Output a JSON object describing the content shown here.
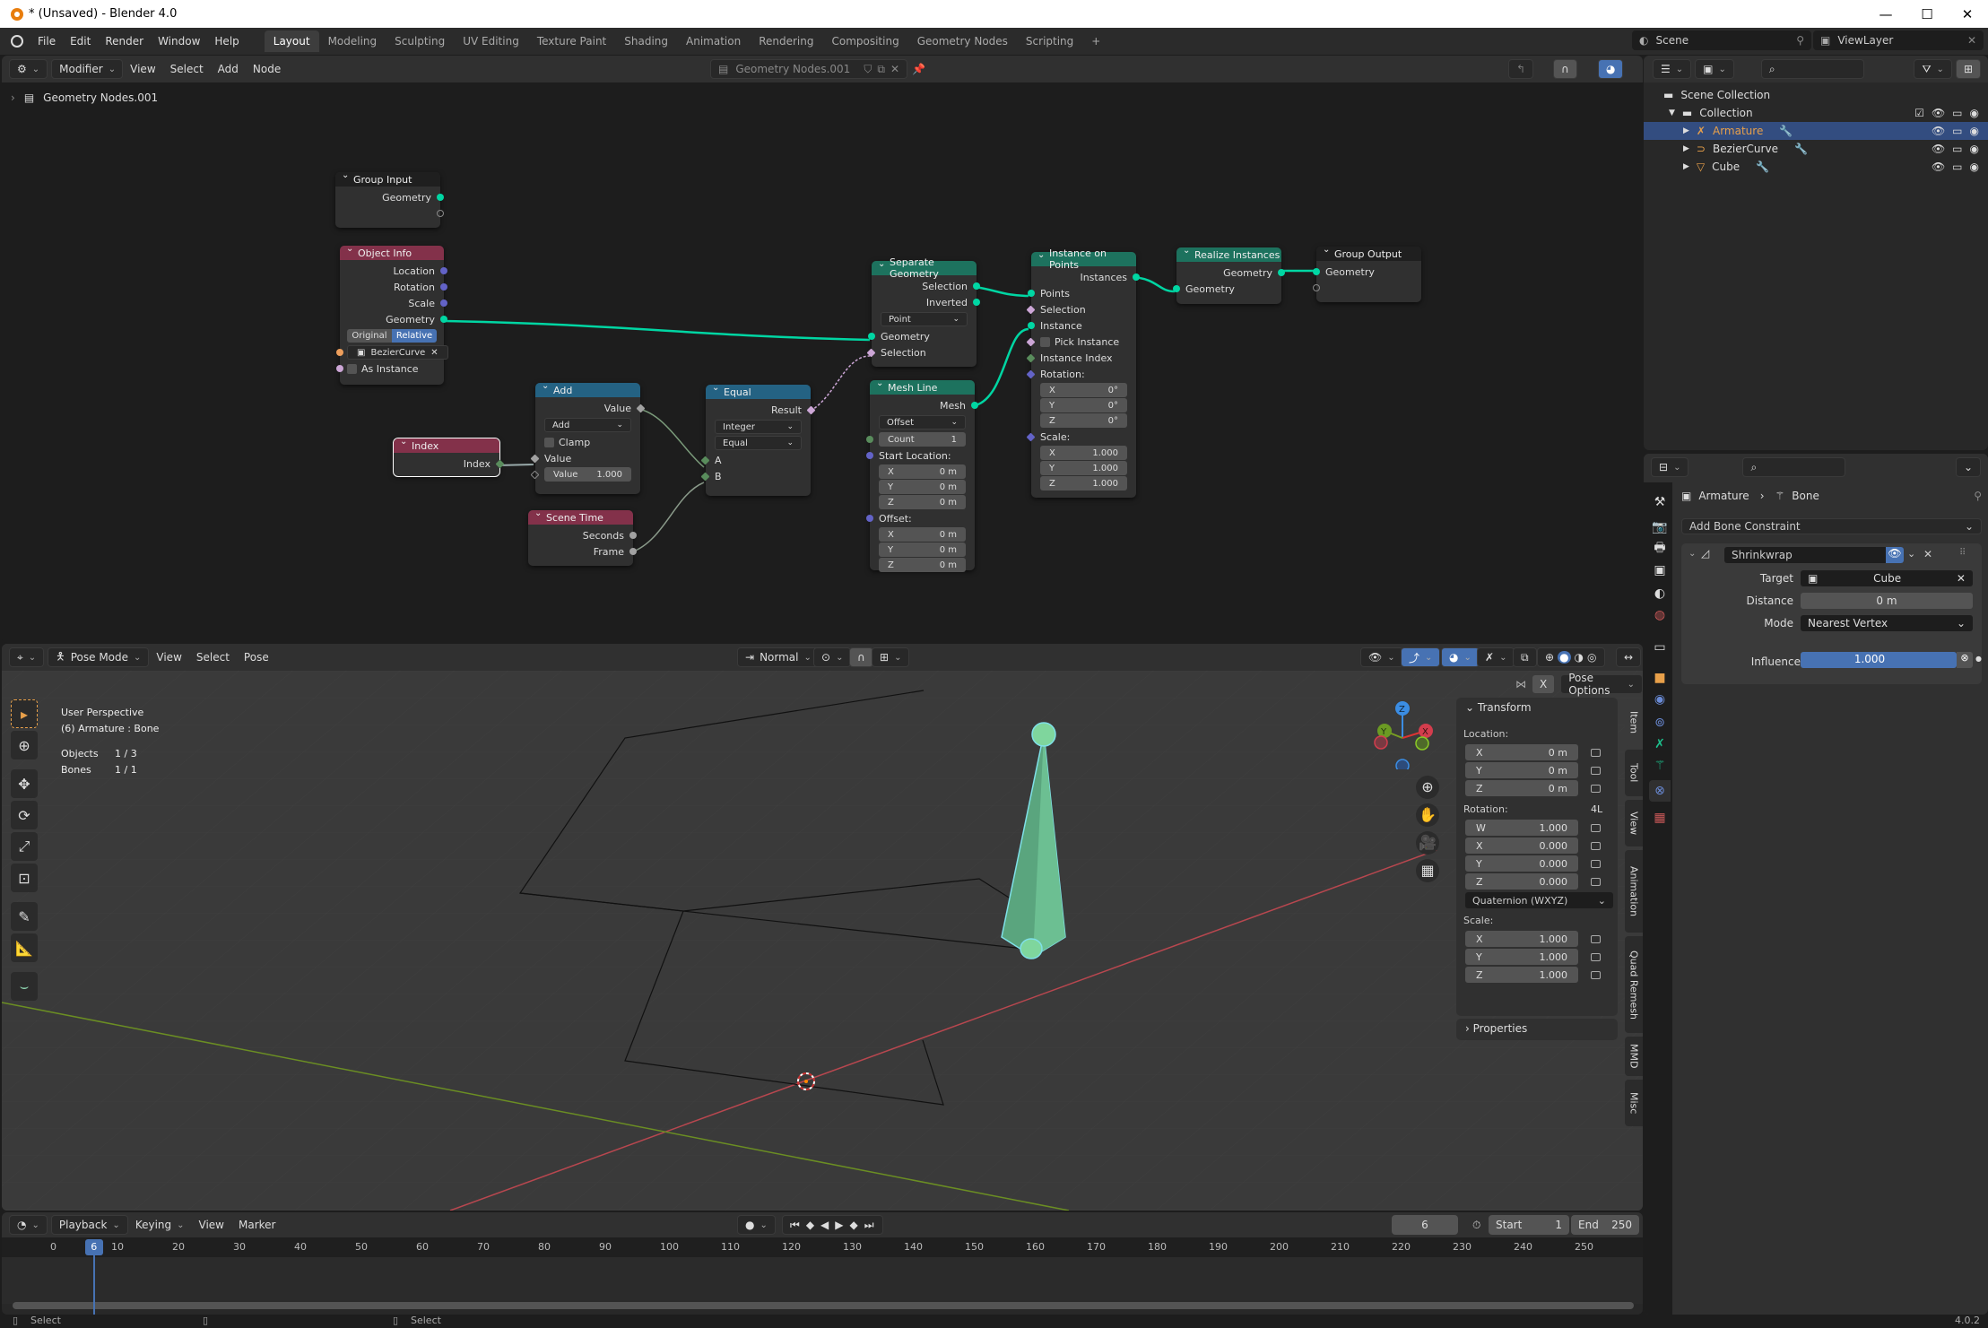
{
  "window": {
    "title": "* (Unsaved) - Blender 4.0",
    "minimize": "—",
    "maximize": "☐",
    "close": "✕"
  },
  "menubar": {
    "menus": [
      "File",
      "Edit",
      "Render",
      "Window",
      "Help"
    ],
    "workspaces": [
      "Layout",
      "Modeling",
      "Sculpting",
      "UV Editing",
      "Texture Paint",
      "Shading",
      "Animation",
      "Rendering",
      "Compositing",
      "Geometry Nodes",
      "Scripting"
    ],
    "active_workspace": "Layout",
    "add_workspace": "+",
    "scene": "Scene",
    "view_layer": "ViewLayer"
  },
  "node_editor": {
    "header": {
      "mode": "Modifier",
      "menus": [
        "View",
        "Select",
        "Add",
        "Node"
      ],
      "node_group": "Geometry Nodes.001"
    },
    "breadcrumb": "Geometry Nodes.001",
    "nodes": {
      "group_input": {
        "title": "Group Input",
        "outputs": [
          "Geometry"
        ]
      },
      "object_info": {
        "title": "Object Info",
        "outputs": [
          "Location",
          "Rotation",
          "Scale",
          "Geometry"
        ],
        "toggle": [
          "Original",
          "Relative"
        ],
        "active_toggle": "Relative",
        "object": "BezierCurve",
        "as_instance": "As Instance"
      },
      "index": {
        "title": "Index",
        "output": "Index"
      },
      "add": {
        "title": "Add",
        "output": "Value",
        "operation": "Add",
        "clamp": "Clamp",
        "input_a": "Value",
        "input_b_label": "Value",
        "input_b_value": "1.000"
      },
      "scene_time": {
        "title": "Scene Time",
        "outputs": [
          "Seconds",
          "Frame"
        ]
      },
      "equal": {
        "title": "Equal",
        "output": "Result",
        "data_type": "Integer",
        "mode": "Equal",
        "inputs": [
          "A",
          "B"
        ]
      },
      "separate_geometry": {
        "title": "Separate Geometry",
        "outputs": [
          "Selection",
          "Inverted"
        ],
        "domain": "Point",
        "inputs": [
          "Geometry",
          "Selection"
        ]
      },
      "mesh_line": {
        "title": "Mesh Line",
        "output": "Mesh",
        "mode": "Offset",
        "count_label": "Count",
        "count": "1",
        "start_label": "Start Location:",
        "start": [
          [
            "X",
            "0 m"
          ],
          [
            "Y",
            "0 m"
          ],
          [
            "Z",
            "0 m"
          ]
        ],
        "offset_label": "Offset:",
        "offset": [
          [
            "X",
            "0 m"
          ],
          [
            "Y",
            "0 m"
          ],
          [
            "Z",
            "0 m"
          ]
        ]
      },
      "instance_on_points": {
        "title": "Instance on Points",
        "output": "Instances",
        "inputs": [
          "Points",
          "Selection",
          "Instance",
          "Pick Instance",
          "Instance Index"
        ],
        "rotation_label": "Rotation:",
        "rotation": [
          [
            "X",
            "0°"
          ],
          [
            "Y",
            "0°"
          ],
          [
            "Z",
            "0°"
          ]
        ],
        "scale_label": "Scale:",
        "scale": [
          [
            "X",
            "1.000"
          ],
          [
            "Y",
            "1.000"
          ],
          [
            "Z",
            "1.000"
          ]
        ]
      },
      "realize_instances": {
        "title": "Realize Instances",
        "output": "Geometry",
        "input": "Geometry"
      },
      "group_output": {
        "title": "Group Output",
        "input": "Geometry"
      }
    }
  },
  "outliner": {
    "root": "Scene Collection",
    "collection": "Collection",
    "items": [
      {
        "name": "Armature",
        "selected": true,
        "color": "#e8a04a"
      },
      {
        "name": "BezierCurve",
        "selected": false,
        "color": "#dddddd"
      },
      {
        "name": "Cube",
        "selected": false,
        "color": "#dddddd"
      }
    ]
  },
  "properties": {
    "breadcrumb": [
      "Armature",
      "Bone"
    ],
    "add_constraint": "Add Bone Constraint",
    "constraint": {
      "name": "Shrinkwrap",
      "fields": [
        {
          "label": "Target",
          "value": "Cube"
        },
        {
          "label": "Distance",
          "value": "0 m"
        },
        {
          "label": "Mode",
          "value": "Nearest Vertex"
        }
      ],
      "influence_label": "Influence",
      "influence": "1.000",
      "influence_fraction": 1.0
    }
  },
  "viewport": {
    "header": {
      "mode": "Pose Mode",
      "menus": [
        "View",
        "Select",
        "Pose"
      ],
      "orientation": "Normal",
      "pose_options": "Pose Options",
      "mirror_x": "X"
    },
    "overlay": {
      "perspective": "User Perspective",
      "context": "(6) Armature : Bone",
      "stats": [
        [
          "Objects",
          "1 / 3"
        ],
        [
          "Bones",
          "1 / 1"
        ]
      ]
    },
    "gizmo_axes": [
      "X",
      "Y",
      "Z"
    ],
    "npanel": {
      "title": "Transform",
      "location_label": "Location:",
      "location": [
        [
          "X",
          "0 m"
        ],
        [
          "Y",
          "0 m"
        ],
        [
          "Z",
          "0 m"
        ]
      ],
      "rotation_label": "Rotation:",
      "rotation_lock": "4L",
      "rotation": [
        [
          "W",
          "1.000"
        ],
        [
          "X",
          "0.000"
        ],
        [
          "Y",
          "0.000"
        ],
        [
          "Z",
          "0.000"
        ]
      ],
      "rotation_mode": "Quaternion (WXYZ)",
      "scale_label": "Scale:",
      "scale": [
        [
          "X",
          "1.000"
        ],
        [
          "Y",
          "1.000"
        ],
        [
          "Z",
          "1.000"
        ]
      ],
      "properties": "Properties",
      "tabs": [
        "Item",
        "Tool",
        "View",
        "Animation",
        "Quad Remesh",
        "MMD",
        "Misc"
      ]
    }
  },
  "timeline": {
    "menus": [
      "Playback",
      "Keying",
      "View",
      "Marker"
    ],
    "current_frame": "6",
    "start_label": "Start",
    "start": "1",
    "end_label": "End",
    "end": "250",
    "ticks": [
      "0",
      "10",
      "20",
      "30",
      "40",
      "50",
      "60",
      "70",
      "80",
      "90",
      "100",
      "110",
      "120",
      "130",
      "140",
      "150",
      "160",
      "170",
      "180",
      "190",
      "200",
      "210",
      "220",
      "230",
      "240",
      "250"
    ]
  },
  "statusbar": {
    "left": "Select",
    "right": "Select",
    "version": "4.0.2"
  }
}
